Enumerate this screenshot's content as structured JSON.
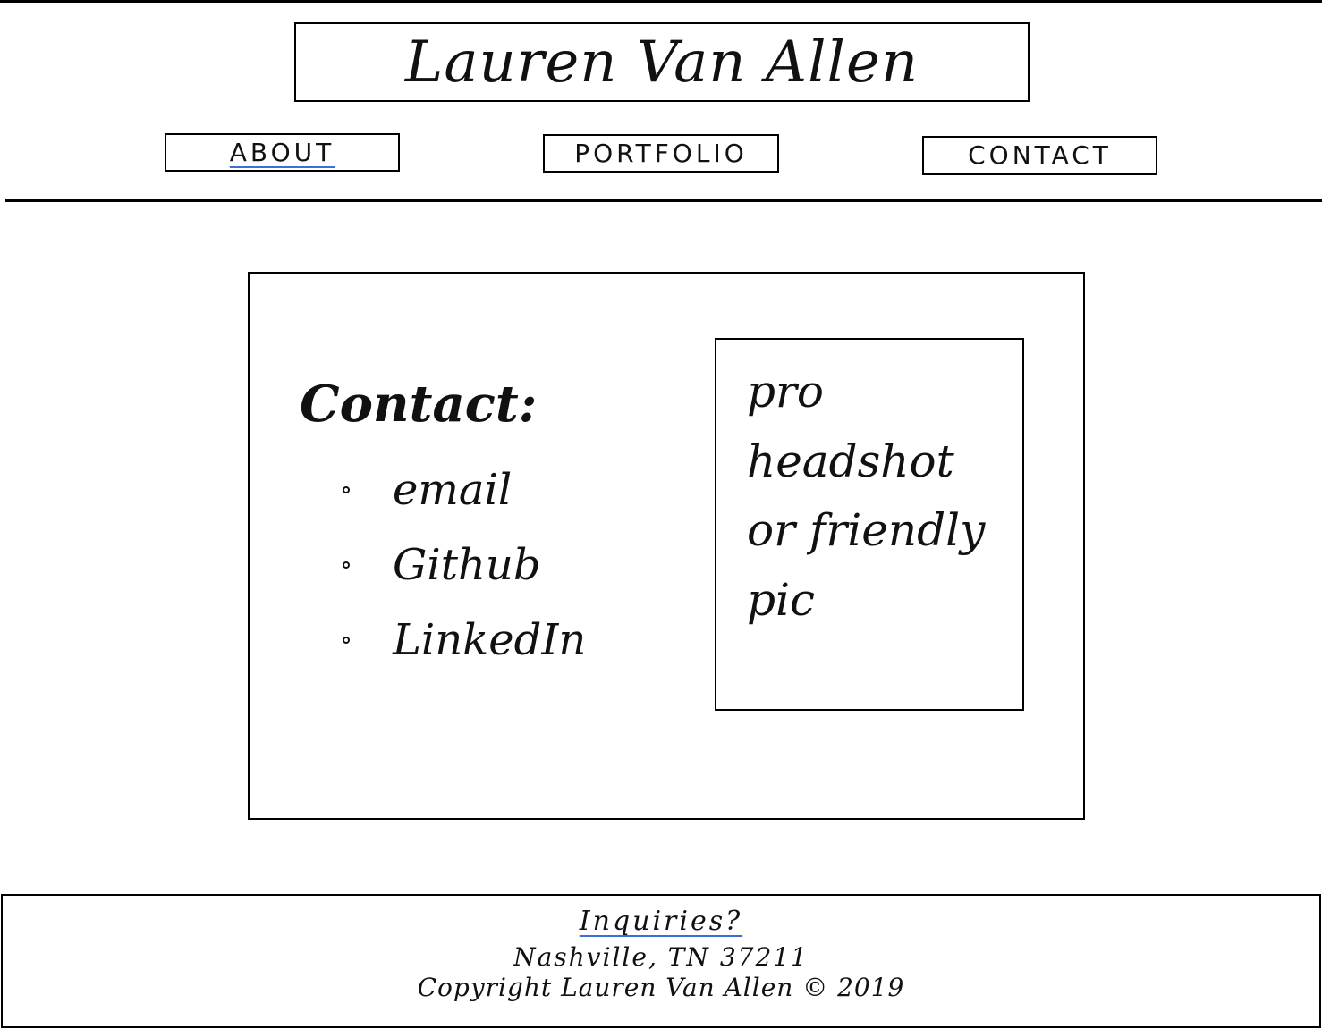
{
  "header": {
    "site_title": "Lauren Van Allen"
  },
  "nav": {
    "about": "ABOUT",
    "portfolio": "PORTFOLIO",
    "contact": "CONTACT",
    "active_item": "about",
    "active_underline_color": "#3a6fd8"
  },
  "main": {
    "contact_heading": "Contact:",
    "contact_links": [
      "email",
      "Github",
      "LinkedIn"
    ],
    "headshot_placeholder": "pro headshot or friendly pic"
  },
  "footer": {
    "inquiries": "Inquiries?",
    "address": "Nashville, TN 37211",
    "copyright": "Copyright Lauren Van Allen © 2019"
  }
}
